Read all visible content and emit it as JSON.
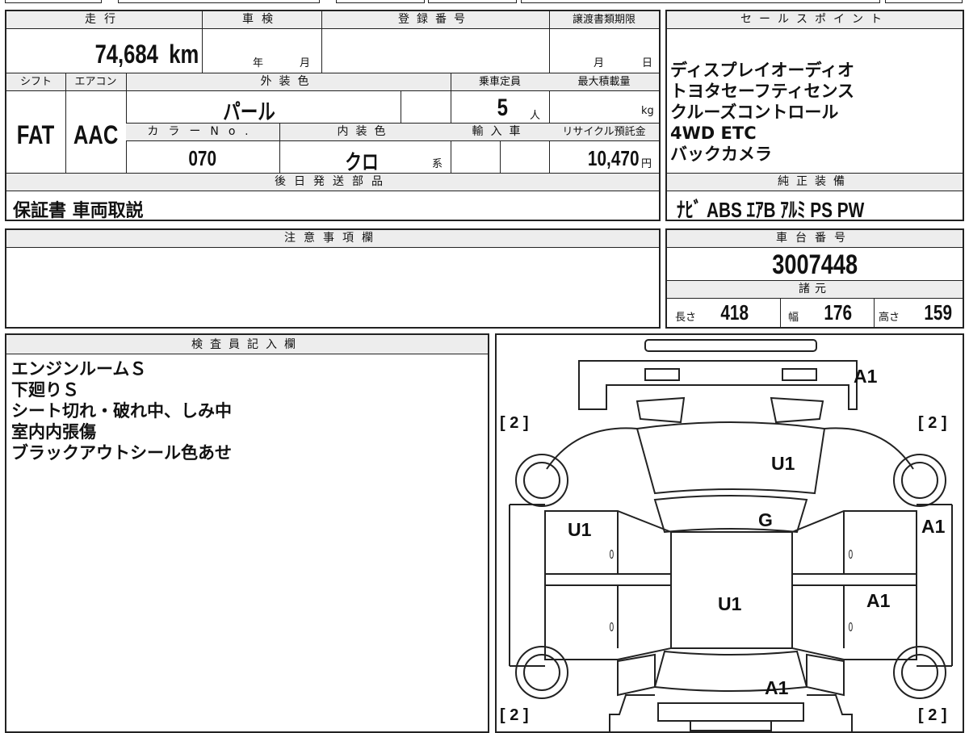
{
  "headers": {
    "mileage": "走行",
    "inspection": "車検",
    "registration": "登録番号",
    "transfer_deadline": "譲渡書類期限",
    "sale_points": "セールスポイント",
    "shift": "シフト",
    "aircon": "エアコン",
    "exterior_color": "外装色",
    "capacity": "乗車定員",
    "max_load": "最大積載量",
    "color_no": "カラーNo.",
    "interior_color": "内装色",
    "import": "輸入車",
    "recycle_fee": "リサイクル預託金",
    "later_parts": "後日発送部品",
    "factory_equipment": "純正装備",
    "notes": "注意事項欄",
    "chassis_no": "車台番号",
    "specs": "諸元",
    "inspector": "検査員記入欄"
  },
  "values": {
    "mileage": "74,684",
    "mileage_unit": "km",
    "inspection_year": "年",
    "inspection_month": "月",
    "deadline_month": "月",
    "deadline_day": "日",
    "shift": "FAT",
    "aircon": "AAC",
    "exterior_color": "パール",
    "capacity": "5",
    "capacity_unit": "人",
    "load_unit": "kg",
    "color_no": "070",
    "interior_color": "クロ",
    "interior_suffix": "系",
    "recycle_fee": "10,470",
    "recycle_unit": "円",
    "later_parts": "保証書 車両取説",
    "factory_equipment": "ﾅﾋﾞ ABS ｴｱB ｱﾙﾐ PS PW",
    "chassis_no": "3007448",
    "length_label": "長さ",
    "length": "418",
    "width_label": "幅",
    "width": "176",
    "height_label": "高さ",
    "height": "159"
  },
  "sale_points": [
    "ディスプレイオーディオ",
    "トヨタセーフティセンス",
    "クルーズコントロール",
    "4WD ETC",
    "バックカメラ"
  ],
  "inspector_notes": [
    "エンジンルームＳ",
    "下廻りＳ",
    "シート切れ・破れ中、しみ中",
    "室内内張傷",
    "ブラックアウトシール色あせ"
  ],
  "diagram": {
    "tire_label_tl": "[ 2 ]",
    "tire_label_tr": "[ 2 ]",
    "tire_label_bl": "[ 2 ]",
    "tire_label_br": "[ 2 ]",
    "mark_front_bumper": "A1",
    "mark_hood": "U1",
    "mark_windshield": "G",
    "mark_roof": "U1",
    "mark_front_left_door": "U1",
    "mark_right_fender": "A1",
    "mark_rear_right_door": "A1",
    "mark_rear": "A1",
    "zero": "0"
  }
}
